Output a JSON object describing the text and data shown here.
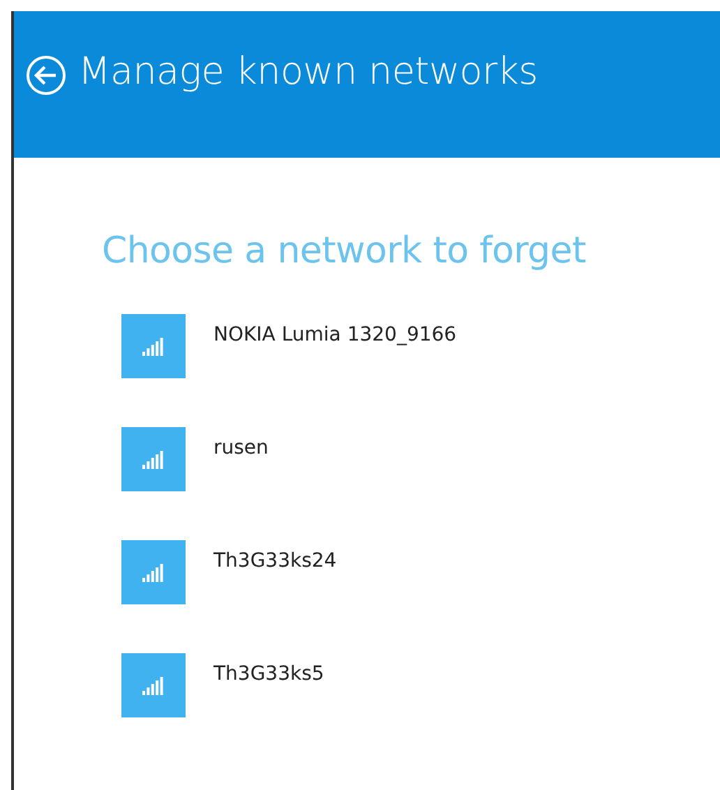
{
  "header": {
    "title": "Manage known networks"
  },
  "heading": "Choose a network to forget",
  "networks": [
    {
      "name": "NOKIA Lumia 1320_9166"
    },
    {
      "name": "rusen"
    },
    {
      "name": "Th3G33ks24"
    },
    {
      "name": "Th3G33ks5"
    }
  ]
}
